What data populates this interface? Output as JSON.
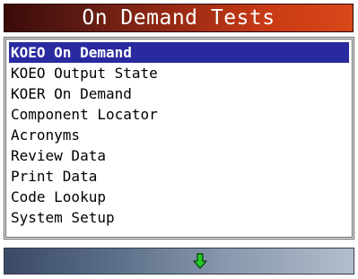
{
  "title_bar": {
    "title": "On Demand Tests",
    "colors": {
      "gradient_start": "#3a0a08",
      "gradient_end": "#d8481a",
      "text": "#ffffff"
    }
  },
  "menu": {
    "selected_index": 0,
    "selected_color": "#2a2aa0",
    "items": [
      {
        "label": "KOEO On Demand"
      },
      {
        "label": "KOEO Output State"
      },
      {
        "label": "KOER On Demand"
      },
      {
        "label": "Component Locator"
      },
      {
        "label": "Acronyms"
      },
      {
        "label": "Review Data"
      },
      {
        "label": "Print Data"
      },
      {
        "label": "Code Lookup"
      },
      {
        "label": "System Setup"
      }
    ]
  },
  "status_bar": {
    "icon": "green-down-arrow-icon",
    "icon_color": "#22cc22"
  }
}
